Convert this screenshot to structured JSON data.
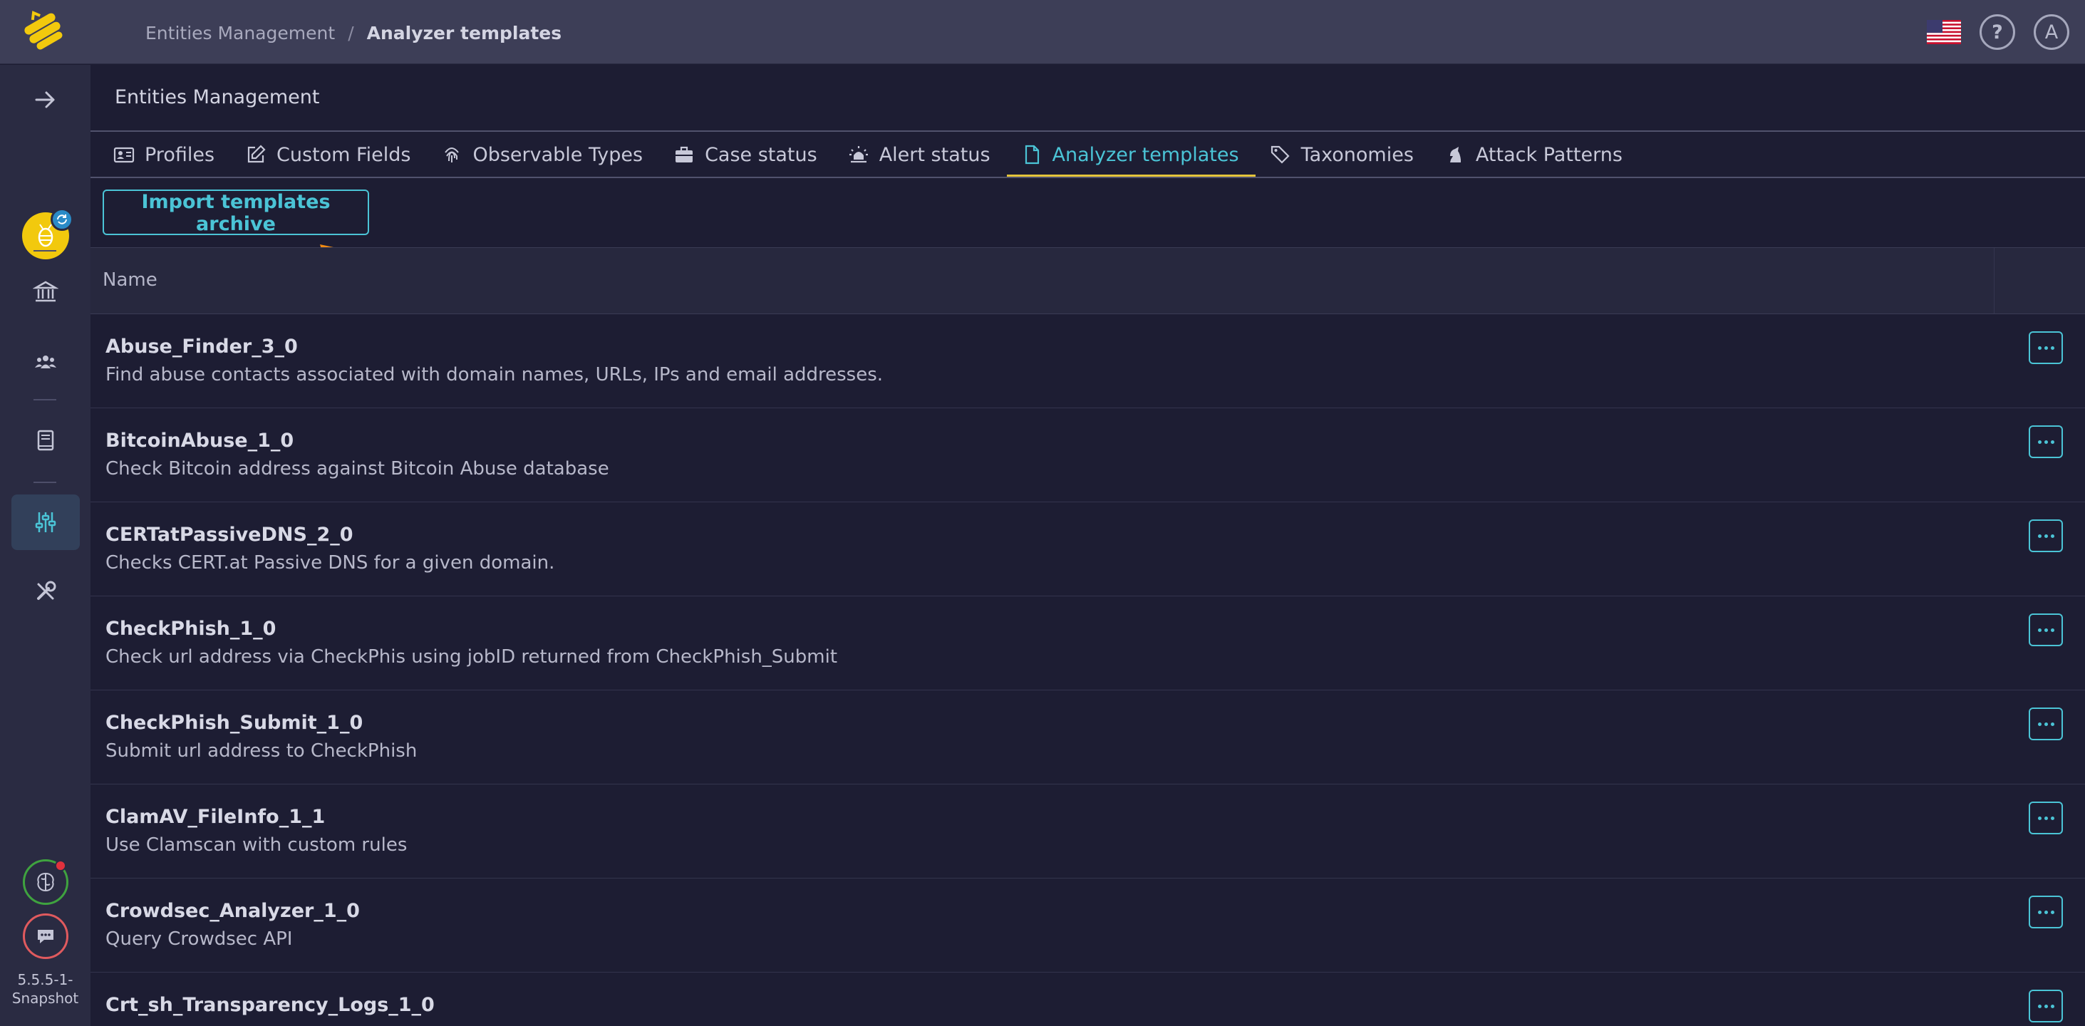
{
  "topbar": {
    "breadcrumb_parent": "Entities Management",
    "breadcrumb_separator": "/",
    "breadcrumb_current": "Analyzer templates",
    "avatar_initial": "A",
    "help_glyph": "?"
  },
  "sidebar": {
    "version": "5.5.5-1-Snapshot"
  },
  "main": {
    "section_title": "Entities Management",
    "tabs": [
      {
        "label": "Profiles",
        "icon": "id-card-icon"
      },
      {
        "label": "Custom Fields",
        "icon": "edit-icon"
      },
      {
        "label": "Observable Types",
        "icon": "fingerprint-icon"
      },
      {
        "label": "Case status",
        "icon": "briefcase-icon"
      },
      {
        "label": "Alert status",
        "icon": "siren-icon"
      },
      {
        "label": "Analyzer templates",
        "icon": "file-icon"
      },
      {
        "label": "Taxonomies",
        "icon": "tags-icon"
      },
      {
        "label": "Attack Patterns",
        "icon": "chess-knight-icon"
      }
    ],
    "active_tab": "Analyzer templates",
    "import_button": "Import templates archive",
    "table": {
      "column_name": "Name",
      "rows": [
        {
          "name": "Abuse_Finder_3_0",
          "description": "Find abuse contacts associated with domain names, URLs, IPs and email addresses."
        },
        {
          "name": "BitcoinAbuse_1_0",
          "description": "Check Bitcoin address against Bitcoin Abuse database"
        },
        {
          "name": "CERTatPassiveDNS_2_0",
          "description": "Checks CERT.at Passive DNS for a given domain."
        },
        {
          "name": "CheckPhish_1_0",
          "description": "Check url address via CheckPhis using jobID returned from CheckPhish_Submit"
        },
        {
          "name": "CheckPhish_Submit_1_0",
          "description": "Submit url address to CheckPhish"
        },
        {
          "name": "ClamAV_FileInfo_1_1",
          "description": "Use Clamscan with custom rules"
        },
        {
          "name": "Crowdsec_Analyzer_1_0",
          "description": "Query Crowdsec API"
        },
        {
          "name": "Crt_sh_Transparency_Logs_1_0",
          "description": ""
        }
      ]
    }
  },
  "colors": {
    "accent": "#4bc4d6",
    "tab_underline": "#e5c53b",
    "annotation_arrow": "#f08a12"
  }
}
